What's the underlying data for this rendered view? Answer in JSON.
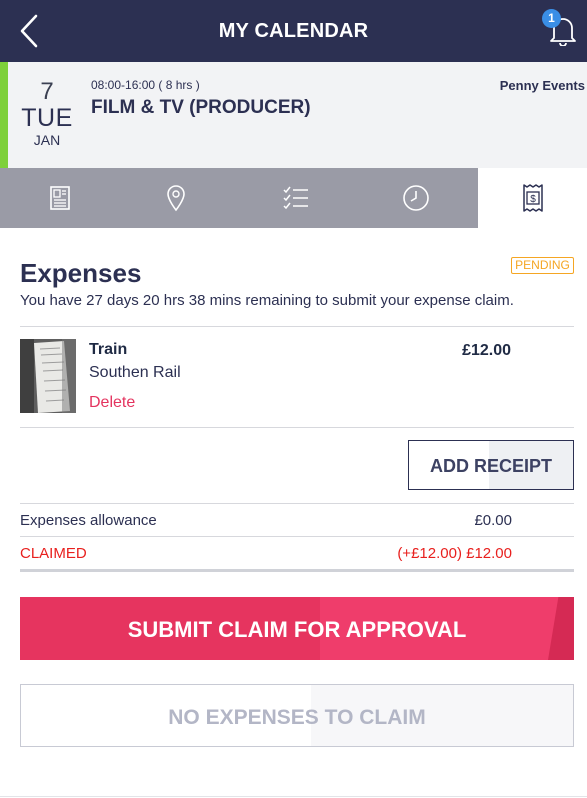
{
  "header": {
    "title": "MY CALENDAR",
    "notification_count": "1",
    "back_icon": "chevron-left-icon",
    "bell_icon": "bell-icon"
  },
  "event": {
    "day": "7",
    "weekday": "TUE",
    "month": "JAN",
    "time": "08:00-16:00 ( 8 hrs )",
    "title": "FILM & TV (PRODUCER)",
    "organizer": "Penny Events",
    "status_color": "#7ed03a"
  },
  "tabs": [
    {
      "icon": "document-icon",
      "active": false
    },
    {
      "icon": "location-pin-icon",
      "active": false
    },
    {
      "icon": "checklist-icon",
      "active": false
    },
    {
      "icon": "clock-icon",
      "active": false
    },
    {
      "icon": "receipt-icon",
      "active": true
    }
  ],
  "expenses": {
    "title": "Expenses",
    "status": "PENDING",
    "remaining_text": "You have 27 days 20 hrs 38 mins remaining to submit your expense claim.",
    "items": [
      {
        "name": "Train",
        "description": "Southen Rail",
        "delete_label": "Delete",
        "amount": "£12.00"
      }
    ],
    "add_receipt_label": "ADD RECEIPT",
    "allowance_label": "Expenses allowance",
    "allowance_value": "£0.00",
    "claimed_label": "CLAIMED",
    "claimed_value": "(+£12.00) £12.00",
    "submit_label": "SUBMIT CLAIM FOR APPROVAL",
    "no_expenses_label": "NO EXPENSES TO CLAIM"
  },
  "colors": {
    "header_bg": "#2c3052",
    "accent_pink": "#e6345f",
    "pending_orange": "#f5a623",
    "claimed_red": "#e8201e"
  }
}
